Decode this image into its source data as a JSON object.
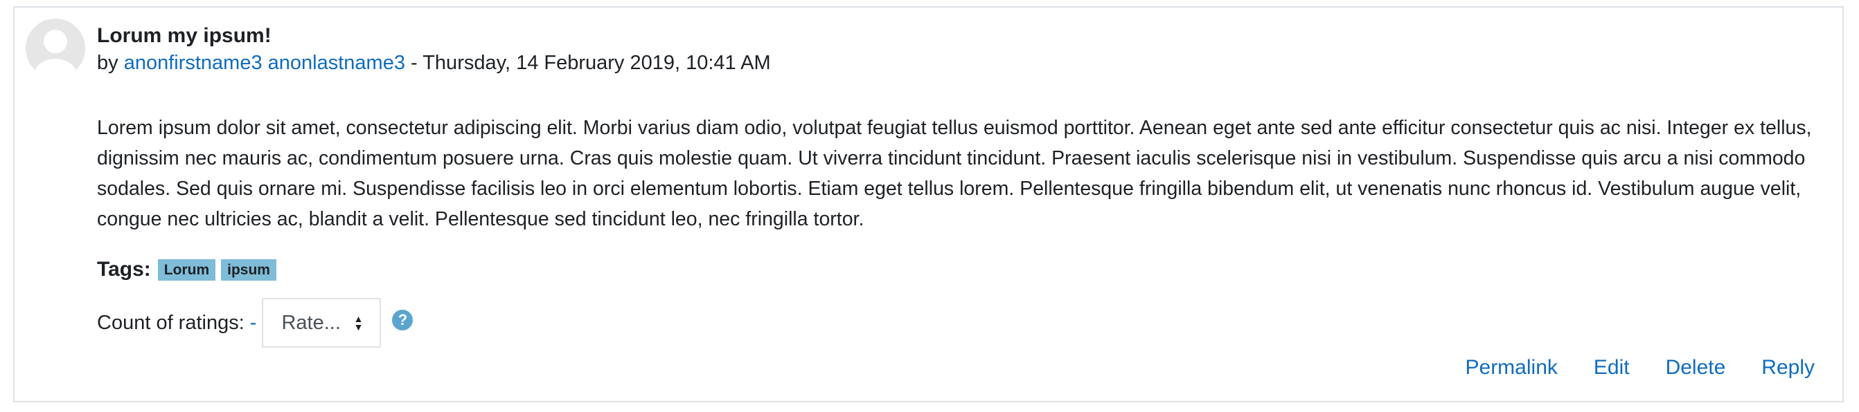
{
  "post": {
    "subject": "Lorum my ipsum!",
    "byline_prefix": "by ",
    "author": "anonfirstname3 anonlastname3",
    "date": " - Thursday, 14 February 2019, 10:41 AM",
    "content": "Lorem ipsum dolor sit amet, consectetur adipiscing elit. Morbi varius diam odio, volutpat feugiat tellus euismod porttitor. Aenean eget ante sed ante efficitur consectetur quis ac nisi. Integer ex tellus, dignissim nec mauris ac, condimentum posuere urna. Cras quis molestie quam. Ut viverra tincidunt tincidunt. Praesent iaculis scelerisque nisi in vestibulum. Suspendisse quis arcu a nisi commodo sodales. Sed quis ornare mi. Suspendisse facilisis leo in orci elementum lobortis. Etiam eget tellus lorem. Pellentesque fringilla bibendum elit, ut venenatis nunc rhoncus id. Vestibulum augue velit, congue nec ultricies ac, blandit a velit. Pellentesque sed tincidunt leo, nec fringilla tortor.",
    "tags_label": "Tags:",
    "tags": [
      "Lorum",
      "ipsum"
    ],
    "rating_label": "Count of ratings:",
    "rating_count": "-",
    "rate_select_value": "Rate...",
    "help_icon": "question-circle-icon",
    "actions": {
      "permalink": "Permalink",
      "edit": "Edit",
      "delete": "Delete",
      "reply": "Reply"
    }
  },
  "colors": {
    "link": "#0f6cbf",
    "tag_bg": "#7fbcd8",
    "border": "#dee2e6",
    "help_icon": "#5aa5cf"
  }
}
